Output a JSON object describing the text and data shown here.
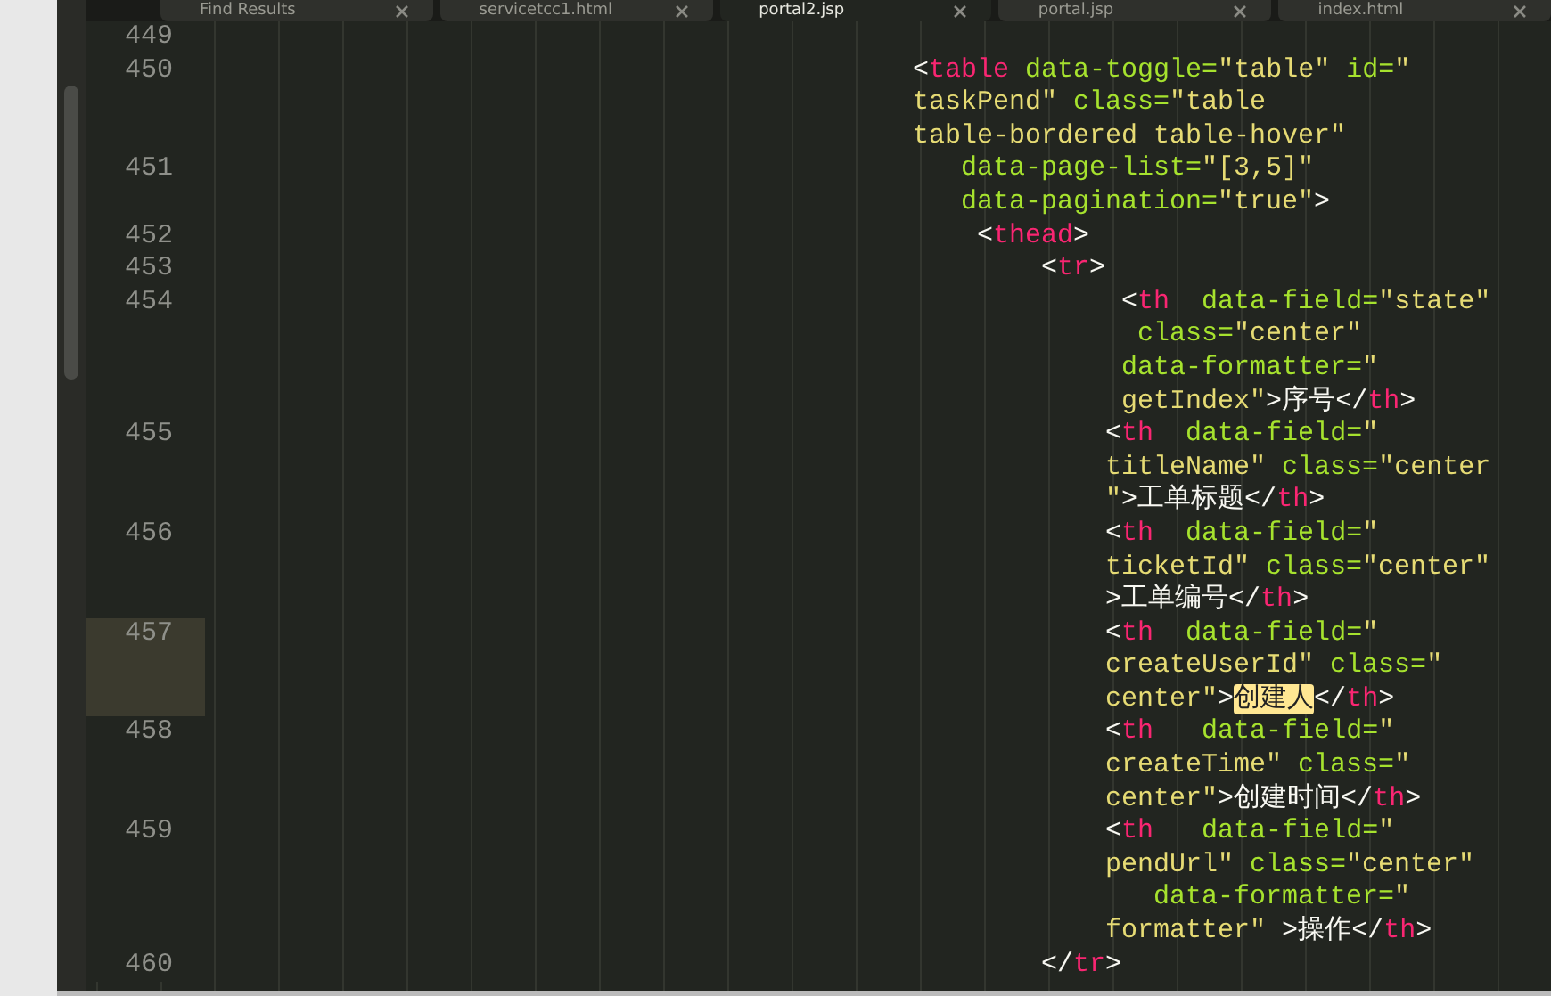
{
  "tabs": [
    {
      "label": "Find Results",
      "selected": false
    },
    {
      "label": "servicetcc1.html",
      "selected": false
    },
    {
      "label": "portal2.jsp",
      "selected": true
    },
    {
      "label": "portal.jsp",
      "selected": false
    },
    {
      "label": "index.html",
      "selected": false
    }
  ],
  "editor": {
    "lines": [
      {
        "number": "449",
        "highlighted": false
      },
      {
        "number": "450",
        "highlighted": false,
        "rows": [
          {
            "tokens": [
              {
                "kind": "punct",
                "text": "<"
              },
              {
                "kind": "tag",
                "text": "table"
              },
              {
                "kind": "attr",
                "text": " data-toggle="
              },
              {
                "kind": "string",
                "text": "\"table\""
              },
              {
                "kind": "attr",
                "text": " id="
              },
              {
                "kind": "string",
                "text": "\""
              }
            ]
          },
          {
            "tokens": [
              {
                "kind": "string",
                "text": "taskPend\""
              },
              {
                "kind": "attr",
                "text": " class="
              },
              {
                "kind": "string",
                "text": "\"table"
              }
            ]
          },
          {
            "tokens": [
              {
                "kind": "string",
                "text": "table-bordered table-hover\""
              }
            ]
          }
        ]
      },
      {
        "number": "451",
        "highlighted": false,
        "rows": [
          {
            "tokens": [
              {
                "kind": "attr",
                "text": "   data-page-list="
              },
              {
                "kind": "string",
                "text": "\"[3,5]\""
              }
            ]
          },
          {
            "tokens": [
              {
                "kind": "attr",
                "text": "   data-pagination="
              },
              {
                "kind": "string",
                "text": "\"true\""
              },
              {
                "kind": "punct",
                "text": ">"
              }
            ]
          }
        ]
      },
      {
        "number": "452",
        "highlighted": false,
        "rows": [
          {
            "tokens": [
              {
                "kind": "punct",
                "text": "    <"
              },
              {
                "kind": "tag",
                "text": "thead"
              },
              {
                "kind": "punct",
                "text": ">"
              }
            ]
          }
        ]
      },
      {
        "number": "453",
        "highlighted": false,
        "rows": [
          {
            "tokens": [
              {
                "kind": "punct",
                "text": "        <"
              },
              {
                "kind": "tag",
                "text": "tr"
              },
              {
                "kind": "punct",
                "text": ">"
              }
            ]
          }
        ]
      },
      {
        "number": "454",
        "highlighted": false,
        "rows": [
          {
            "tokens": [
              {
                "kind": "punct",
                "text": "             <"
              },
              {
                "kind": "tag",
                "text": "th"
              },
              {
                "kind": "attr",
                "text": "  data-field="
              },
              {
                "kind": "string",
                "text": "\"state\""
              }
            ]
          },
          {
            "tokens": [
              {
                "kind": "attr",
                "text": "              class="
              },
              {
                "kind": "string",
                "text": "\"center\""
              }
            ]
          },
          {
            "tokens": [
              {
                "kind": "attr",
                "text": "             data-formatter="
              },
              {
                "kind": "string",
                "text": "\""
              }
            ]
          },
          {
            "tokens": [
              {
                "kind": "string",
                "text": "             getIndex\""
              },
              {
                "kind": "punct",
                "text": ">"
              },
              {
                "kind": "text",
                "text": "序号"
              },
              {
                "kind": "punct",
                "text": "</"
              },
              {
                "kind": "tag",
                "text": "th"
              },
              {
                "kind": "punct",
                "text": ">"
              }
            ]
          }
        ]
      },
      {
        "number": "455",
        "highlighted": false,
        "rows": [
          {
            "tokens": [
              {
                "kind": "punct",
                "text": "            <"
              },
              {
                "kind": "tag",
                "text": "th"
              },
              {
                "kind": "attr",
                "text": "  data-field="
              },
              {
                "kind": "string",
                "text": "\""
              }
            ]
          },
          {
            "tokens": [
              {
                "kind": "string",
                "text": "            titleName\""
              },
              {
                "kind": "attr",
                "text": " class="
              },
              {
                "kind": "string",
                "text": "\"center"
              }
            ]
          },
          {
            "tokens": [
              {
                "kind": "string",
                "text": "            \""
              },
              {
                "kind": "punct",
                "text": ">"
              },
              {
                "kind": "text",
                "text": "工单标题"
              },
              {
                "kind": "punct",
                "text": "</"
              },
              {
                "kind": "tag",
                "text": "th"
              },
              {
                "kind": "punct",
                "text": ">"
              }
            ]
          }
        ]
      },
      {
        "number": "456",
        "highlighted": false,
        "rows": [
          {
            "tokens": [
              {
                "kind": "punct",
                "text": "            <"
              },
              {
                "kind": "tag",
                "text": "th"
              },
              {
                "kind": "attr",
                "text": "  data-field="
              },
              {
                "kind": "string",
                "text": "\""
              }
            ]
          },
          {
            "tokens": [
              {
                "kind": "string",
                "text": "            ticketId\""
              },
              {
                "kind": "attr",
                "text": " class="
              },
              {
                "kind": "string",
                "text": "\"center\""
              }
            ]
          },
          {
            "tokens": [
              {
                "kind": "punct",
                "text": "            >"
              },
              {
                "kind": "text",
                "text": "工单编号"
              },
              {
                "kind": "punct",
                "text": "</"
              },
              {
                "kind": "tag",
                "text": "th"
              },
              {
                "kind": "punct",
                "text": ">"
              }
            ]
          }
        ]
      },
      {
        "number": "457",
        "highlighted": true,
        "rows": [
          {
            "tokens": [
              {
                "kind": "punct",
                "text": "            <"
              },
              {
                "kind": "tag",
                "text": "th"
              },
              {
                "kind": "attr",
                "text": "  data-field="
              },
              {
                "kind": "string",
                "text": "\""
              }
            ]
          },
          {
            "tokens": [
              {
                "kind": "string",
                "text": "            createUserId\""
              },
              {
                "kind": "attr",
                "text": " class="
              },
              {
                "kind": "string",
                "text": "\""
              }
            ]
          },
          {
            "tokens": [
              {
                "kind": "string",
                "text": "            center\""
              },
              {
                "kind": "punct",
                "text": ">"
              },
              {
                "kind": "match",
                "text": "创建人"
              },
              {
                "kind": "punct",
                "text": "</"
              },
              {
                "kind": "tag",
                "text": "th"
              },
              {
                "kind": "punct",
                "text": ">"
              }
            ]
          }
        ]
      },
      {
        "number": "458",
        "highlighted": false,
        "rows": [
          {
            "tokens": [
              {
                "kind": "punct",
                "text": "            <"
              },
              {
                "kind": "tag",
                "text": "th"
              },
              {
                "kind": "attr",
                "text": "   data-field="
              },
              {
                "kind": "string",
                "text": "\""
              }
            ]
          },
          {
            "tokens": [
              {
                "kind": "string",
                "text": "            createTime\""
              },
              {
                "kind": "attr",
                "text": " class="
              },
              {
                "kind": "string",
                "text": "\""
              }
            ]
          },
          {
            "tokens": [
              {
                "kind": "string",
                "text": "            center\""
              },
              {
                "kind": "punct",
                "text": ">"
              },
              {
                "kind": "text",
                "text": "创建时间"
              },
              {
                "kind": "punct",
                "text": "</"
              },
              {
                "kind": "tag",
                "text": "th"
              },
              {
                "kind": "punct",
                "text": ">"
              }
            ]
          }
        ]
      },
      {
        "number": "459",
        "highlighted": false,
        "rows": [
          {
            "tokens": [
              {
                "kind": "punct",
                "text": "            <"
              },
              {
                "kind": "tag",
                "text": "th"
              },
              {
                "kind": "attr",
                "text": "   data-field="
              },
              {
                "kind": "string",
                "text": "\""
              }
            ]
          },
          {
            "tokens": [
              {
                "kind": "string",
                "text": "            pendUrl\""
              },
              {
                "kind": "attr",
                "text": " class="
              },
              {
                "kind": "string",
                "text": "\"center\""
              }
            ]
          },
          {
            "tokens": [
              {
                "kind": "attr",
                "text": "               data-formatter="
              },
              {
                "kind": "string",
                "text": "\""
              }
            ]
          },
          {
            "tokens": [
              {
                "kind": "string",
                "text": "            formatter\""
              },
              {
                "kind": "punct",
                "text": " >"
              },
              {
                "kind": "text",
                "text": "操作"
              },
              {
                "kind": "punct",
                "text": "</"
              },
              {
                "kind": "tag",
                "text": "th"
              },
              {
                "kind": "punct",
                "text": ">"
              }
            ]
          }
        ]
      },
      {
        "number": "460",
        "highlighted": false,
        "rows": [
          {
            "tokens": [
              {
                "kind": "punct",
                "text": "        </"
              },
              {
                "kind": "tag",
                "text": "tr"
              },
              {
                "kind": "punct",
                "text": ">"
              }
            ]
          }
        ]
      }
    ]
  }
}
